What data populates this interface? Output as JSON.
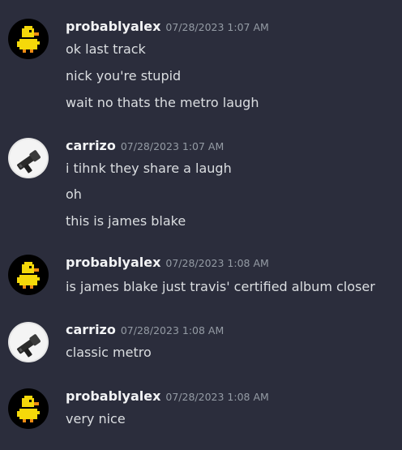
{
  "messages": [
    {
      "author": "probablyalex",
      "avatar": "pixel-duck-icon",
      "timestamp": "07/28/2023 1:07 AM",
      "lines": [
        "ok last track",
        "nick you're stupid",
        "wait no thats the metro laugh"
      ]
    },
    {
      "author": "carrizo",
      "avatar": "gun-photo-icon",
      "timestamp": "07/28/2023 1:07 AM",
      "lines": [
        "i tihnk they share a laugh",
        "oh",
        "this is james blake"
      ]
    },
    {
      "author": "probablyalex",
      "avatar": "pixel-duck-icon",
      "timestamp": "07/28/2023 1:08 AM",
      "lines": [
        "is james blake just travis' certified album closer"
      ]
    },
    {
      "author": "carrizo",
      "avatar": "gun-photo-icon",
      "timestamp": "07/28/2023 1:08 AM",
      "lines": [
        "classic metro"
      ]
    },
    {
      "author": "probablyalex",
      "avatar": "pixel-duck-icon",
      "timestamp": "07/28/2023 1:08 AM",
      "lines": [
        "very nice"
      ]
    }
  ],
  "colors": {
    "background": "#2b2d3c",
    "username": "#f2f3f5",
    "timestamp": "#949ba4",
    "message_text": "#dbdee1",
    "duck_yellow": "#f5d90a"
  }
}
